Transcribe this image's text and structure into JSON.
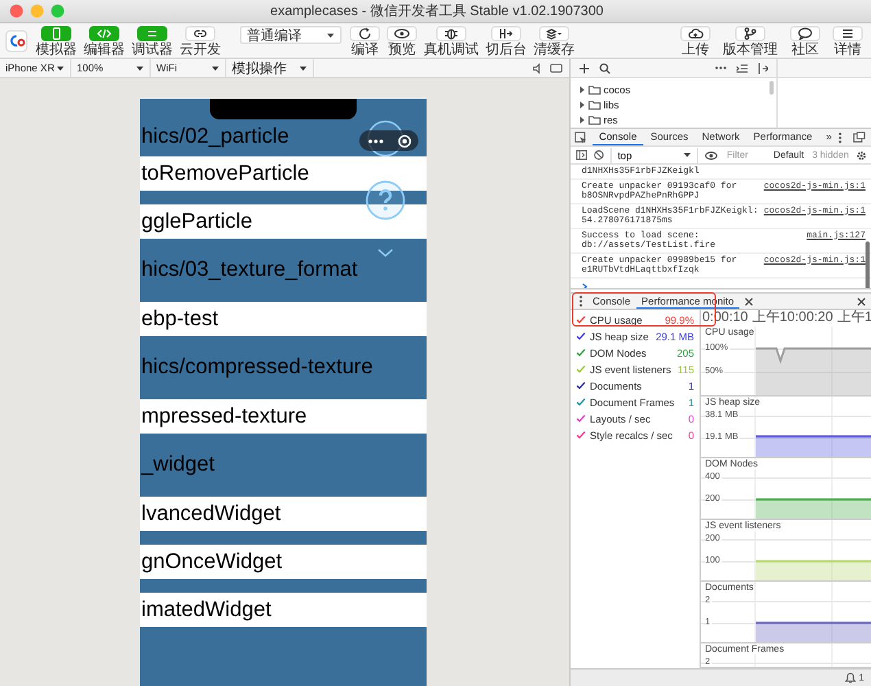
{
  "window": {
    "title": "examplecases - 微信开发者工具 Stable v1.02.1907300"
  },
  "toolbar": {
    "view_buttons": [
      {
        "label": "模拟器",
        "on": true
      },
      {
        "label": "编辑器",
        "on": true
      },
      {
        "label": "调试器",
        "on": true
      },
      {
        "label": "云开发",
        "on": false
      }
    ],
    "compile_mode": "普通编译",
    "actions": [
      {
        "label": "编译"
      },
      {
        "label": "预览"
      },
      {
        "label": "真机调试"
      },
      {
        "label": "切后台"
      },
      {
        "label": "清缓存"
      }
    ],
    "right_actions": [
      {
        "label": "上传"
      },
      {
        "label": "版本管理"
      },
      {
        "label": "社区"
      },
      {
        "label": "详情"
      }
    ]
  },
  "device_bar": {
    "selects": [
      "iPhone XR",
      "100%",
      "WiFi",
      "模拟操作"
    ]
  },
  "simulator": {
    "rows": [
      {
        "kind": "header",
        "text": "hics/02_particle"
      },
      {
        "kind": "item",
        "text": "toRemoveParticle"
      },
      {
        "kind": "item",
        "text": "ggleParticle"
      },
      {
        "kind": "header",
        "text": "hics/03_texture_format"
      },
      {
        "kind": "item",
        "text": "ebp-test"
      },
      {
        "kind": "header",
        "text": "hics/compressed-texture"
      },
      {
        "kind": "item",
        "text": "mpressed-texture"
      },
      {
        "kind": "header",
        "text": "_widget"
      },
      {
        "kind": "item",
        "text": "lvancedWidget"
      },
      {
        "kind": "item",
        "text": "gnOnceWidget"
      },
      {
        "kind": "item",
        "text": "imatedWidget"
      }
    ]
  },
  "devtools": {
    "file_tree": [
      {
        "name": "cocos",
        "expanded": false
      },
      {
        "name": "libs",
        "expanded": false
      },
      {
        "name": "res",
        "expanded": false
      }
    ],
    "tabs": [
      {
        "label": "Console",
        "selected": true
      },
      {
        "label": "Sources",
        "selected": false
      },
      {
        "label": "Network",
        "selected": false
      },
      {
        "label": "Performance",
        "selected": false
      }
    ],
    "more_tabs": "»",
    "console_toolbar": {
      "context": "top",
      "filter": {
        "placeholder": "Filter"
      },
      "levels": "Default",
      "hidden_count": "3 hidden"
    },
    "messages": [
      {
        "text": "d1NHXHs35F1rbFJZKeigkl"
      },
      {
        "text": "Create unpacker 09193caf0 for b8OSNRvpdPAZhePnRhGPPJ",
        "source": "cocos2d-js-min.js:1"
      },
      {
        "text": "LoadScene d1NHXHs35F1rbFJZKeigkl: 54.278076171875ms",
        "source": "cocos2d-js-min.js:1"
      },
      {
        "text": "Success to load scene: db://assets/TestList.fire",
        "source": "main.js:127"
      },
      {
        "text": "Create unpacker 09989be15 for e1RUTbVtdHLaqttbxfIzqk",
        "source": "cocos2d-js-min.js:1"
      }
    ]
  },
  "drawer": {
    "tabs": [
      {
        "label": "Console",
        "selected": false
      },
      {
        "label": "Performance monito",
        "selected": true
      }
    ],
    "metrics": [
      {
        "label": "CPU usage",
        "value": "99.9%",
        "checked": true,
        "color": "#f0403a"
      },
      {
        "label": "JS heap size",
        "value": "29.1 MB",
        "checked": true,
        "color": "#3c3ce0"
      },
      {
        "label": "DOM Nodes",
        "value": "205",
        "checked": true,
        "color": "#2e9e3e"
      },
      {
        "label": "JS event listeners",
        "value": "115",
        "checked": true,
        "color": "#9cc83c"
      },
      {
        "label": "Documents",
        "value": "1",
        "checked": true,
        "color": "#2a2a9a"
      },
      {
        "label": "Document Frames",
        "value": "1",
        "checked": true,
        "color": "#1f8fa8"
      },
      {
        "label": "Layouts / sec",
        "value": "0",
        "checked": true,
        "color": "#e040c8"
      },
      {
        "label": "Style recalcs / sec",
        "value": "0",
        "checked": true,
        "color": "#f03c8c"
      }
    ],
    "time_labels": [
      "0:00:10",
      "上午10:00:20",
      "上午1"
    ],
    "charts": [
      {
        "title": "CPU usage",
        "ticks": [
          "100%",
          "50%"
        ],
        "color": "#9e9e9e"
      },
      {
        "title": "JS heap size",
        "ticks": [
          "38.1 MB",
          "19.1 MB"
        ],
        "color": "#5b5be0"
      },
      {
        "title": "DOM Nodes",
        "ticks": [
          "400",
          "200"
        ],
        "color": "#4caf50"
      },
      {
        "title": "JS event listeners",
        "ticks": [
          "200",
          "100"
        ],
        "color": "#b8d870"
      },
      {
        "title": "Documents",
        "ticks": [
          "2",
          "1"
        ],
        "color": "#6a6ac0"
      },
      {
        "title": "Document Frames",
        "ticks": [
          "2"
        ]
      }
    ]
  },
  "status_bar": {
    "notifications": "1"
  }
}
